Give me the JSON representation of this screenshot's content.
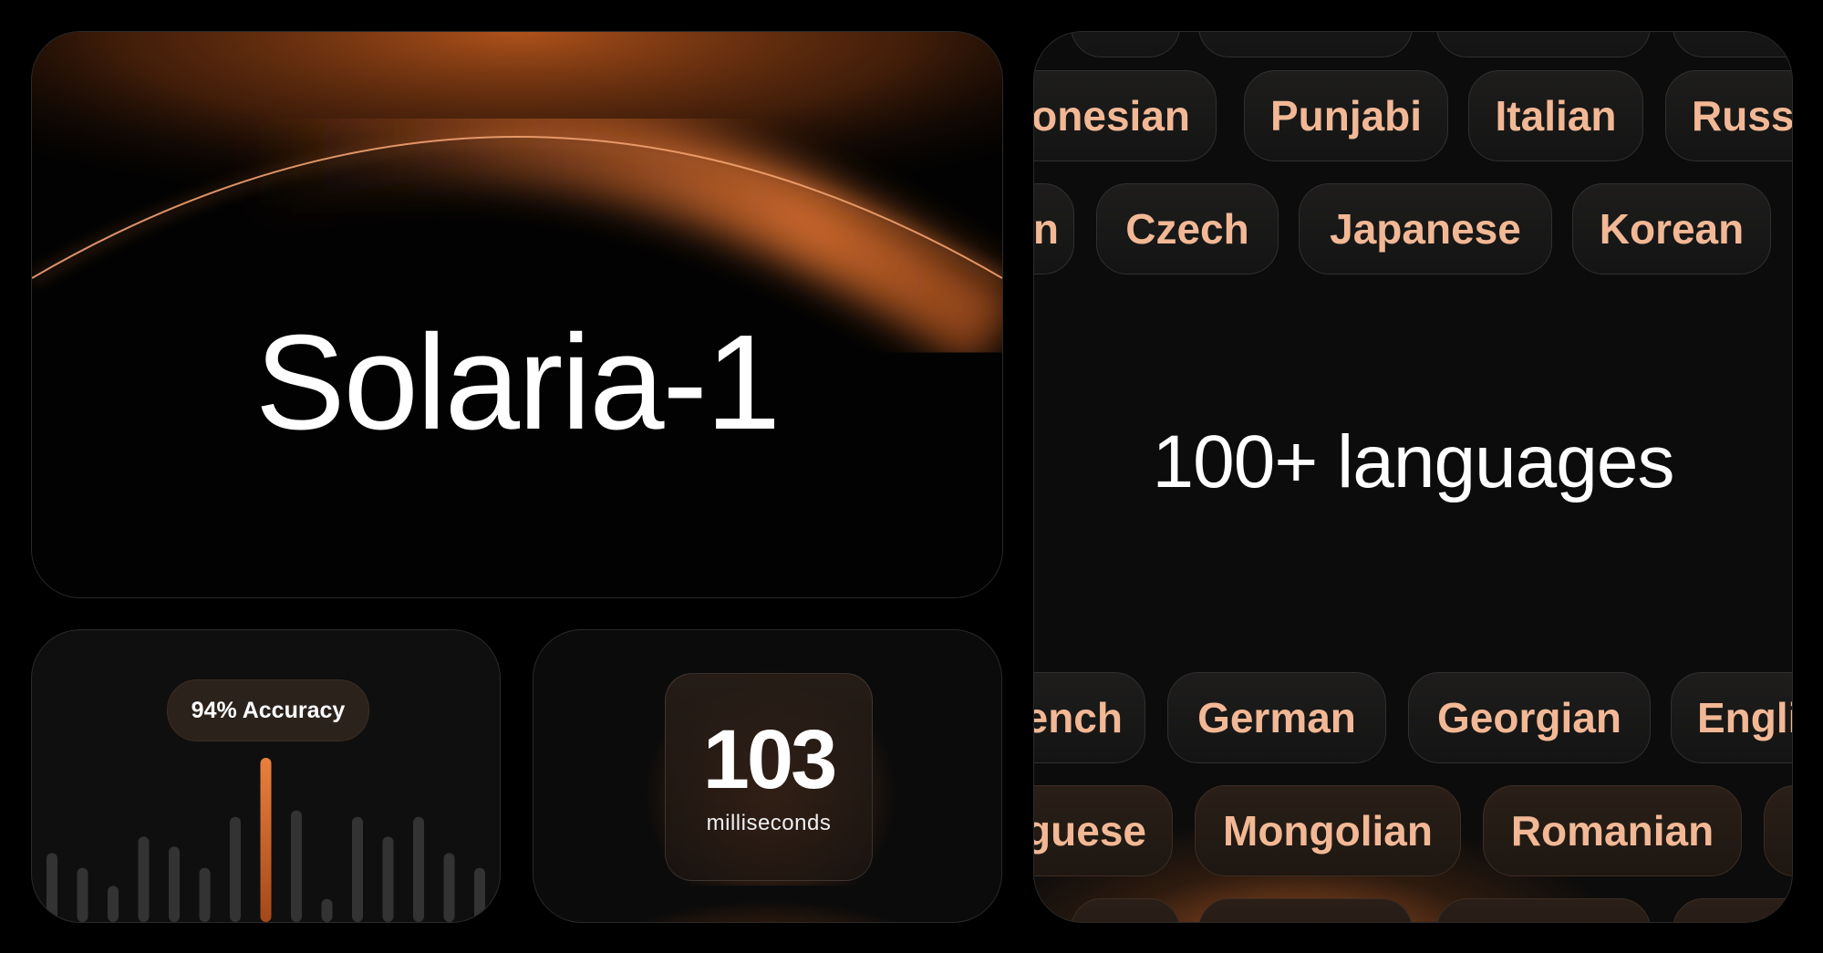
{
  "hero": {
    "title": "Solaria-1"
  },
  "accuracy": {
    "badge": "94% Accuracy",
    "bar_levels": [
      0.42,
      0.33,
      0.22,
      0.52,
      0.46,
      0.33,
      0.64,
      1.0,
      0.68,
      0.14,
      0.64,
      0.52,
      0.64,
      0.42,
      0.33
    ]
  },
  "latency": {
    "value": "103",
    "unit": "milliseconds"
  },
  "languages": {
    "title": "100+ languages",
    "row1": [
      "onesian",
      "Punjabi",
      "Italian",
      "Russ"
    ],
    "row2": [
      "n",
      "Czech",
      "Japanese",
      "Korean"
    ],
    "row3": [
      "ench",
      "German",
      "Georgian",
      "Engli"
    ],
    "row4": [
      "guese",
      "Mongolian",
      "Romanian",
      ""
    ]
  },
  "colors": {
    "accent": "#c8632a",
    "pill_text": "#f2b895",
    "background": "#000000"
  }
}
